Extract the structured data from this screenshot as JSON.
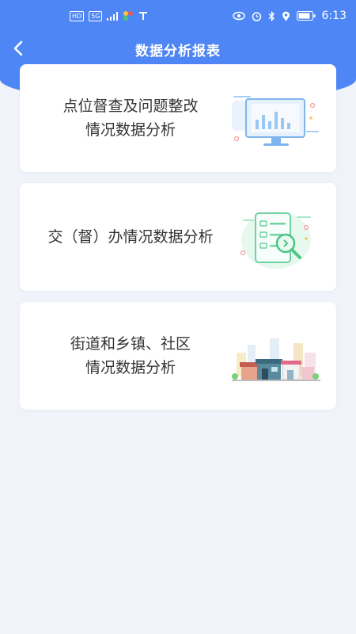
{
  "status_bar": {
    "left_chips": [
      "HD",
      "5G"
    ],
    "time": "6:13"
  },
  "header": {
    "title": "数据分析报表",
    "back_icon": "chevron-left-icon"
  },
  "cards": [
    {
      "line1": "点位督查及问题整改",
      "line2": "情况数据分析",
      "icon": "monitor-chart-icon"
    },
    {
      "line1": "交（督）办情况数据分析",
      "line2": "",
      "icon": "document-search-icon"
    },
    {
      "line1": "街道和乡镇、社区",
      "line2": "情况数据分析",
      "icon": "street-buildings-icon"
    }
  ],
  "colors": {
    "primary": "#4f86f5",
    "background": "#f1f3fa",
    "card": "#ffffff",
    "text": "#333333"
  }
}
